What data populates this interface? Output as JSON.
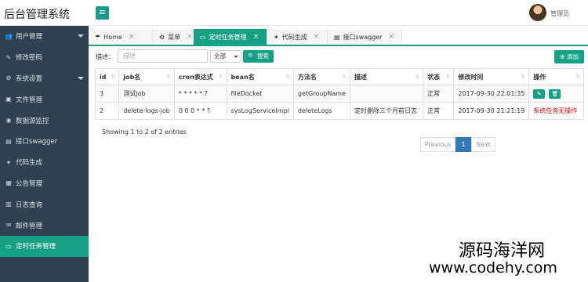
{
  "header": {
    "logo": "后台管理系统",
    "menu_icon": "≡",
    "user_name": "管理员"
  },
  "sidebar": {
    "items": [
      {
        "label": "用户管理",
        "icon": "👥",
        "has_arrow": true,
        "active": false
      },
      {
        "label": "修改密码",
        "icon": "✎",
        "has_arrow": false,
        "active": false
      },
      {
        "label": "系统设置",
        "icon": "⚙",
        "has_arrow": true,
        "active": false
      },
      {
        "label": "文件管理",
        "icon": "▣",
        "has_arrow": false,
        "active": false
      },
      {
        "label": "数据源监控",
        "icon": "◉",
        "has_arrow": false,
        "active": false
      },
      {
        "label": "接口swagger",
        "icon": "▤",
        "has_arrow": false,
        "active": false
      },
      {
        "label": "代码生成",
        "icon": "✦",
        "has_arrow": false,
        "active": false
      },
      {
        "label": "公告管理",
        "icon": "▦",
        "has_arrow": false,
        "active": false
      },
      {
        "label": "日志查询",
        "icon": "▥",
        "has_arrow": false,
        "active": false
      },
      {
        "label": "邮件管理",
        "icon": "✉",
        "has_arrow": false,
        "active": false
      },
      {
        "label": "定时任务管理",
        "icon": "▭",
        "has_arrow": false,
        "active": true
      }
    ]
  },
  "tabs": [
    {
      "label": "Home",
      "icon": "☂",
      "active": false
    },
    {
      "label": "菜单",
      "icon": "⚙",
      "active": false
    },
    {
      "label": "定时任务管理",
      "icon": "▭",
      "active": true
    },
    {
      "label": "代码生成",
      "icon": "✦",
      "active": false
    },
    {
      "label": "接口swagger",
      "icon": "▤",
      "active": false
    }
  ],
  "toolbar": {
    "search_label": "描述：",
    "search_placeholder": "描述",
    "select_value": "全部",
    "search_button": "搜索",
    "search_icon": "🔍",
    "add_button": "添加",
    "add_icon": "⊕"
  },
  "table": {
    "columns": [
      "id",
      "job名",
      "cron表达式",
      "bean名",
      "方法名",
      "描述",
      "状态",
      "修改时间",
      "操作"
    ],
    "rows": [
      {
        "id": "3",
        "job": "测试job",
        "cron": "* * * * * ?",
        "bean": "fileDocket",
        "method": "getGroupName",
        "desc": "",
        "status": "正常",
        "time": "2017-09-30 22:01:35",
        "op_type": "buttons",
        "op_text": ""
      },
      {
        "id": "2",
        "job": "delete-logs-job",
        "cron": "0 0 0 * * ?",
        "bean": "sysLogServiceImpl",
        "method": "deleteLogs",
        "desc": "定时删除三个月前日志",
        "status": "正常",
        "time": "2017-09-30 21:21:19",
        "op_type": "text",
        "op_text": "系统任务无操作"
      }
    ]
  },
  "footer": {
    "entries": "Showing 1 to 2 of 2 entries",
    "prev": "Previous",
    "page": "1",
    "next": "Next"
  },
  "watermark": {
    "line1": "源码海洋网",
    "line2": "www.codehy.com"
  }
}
